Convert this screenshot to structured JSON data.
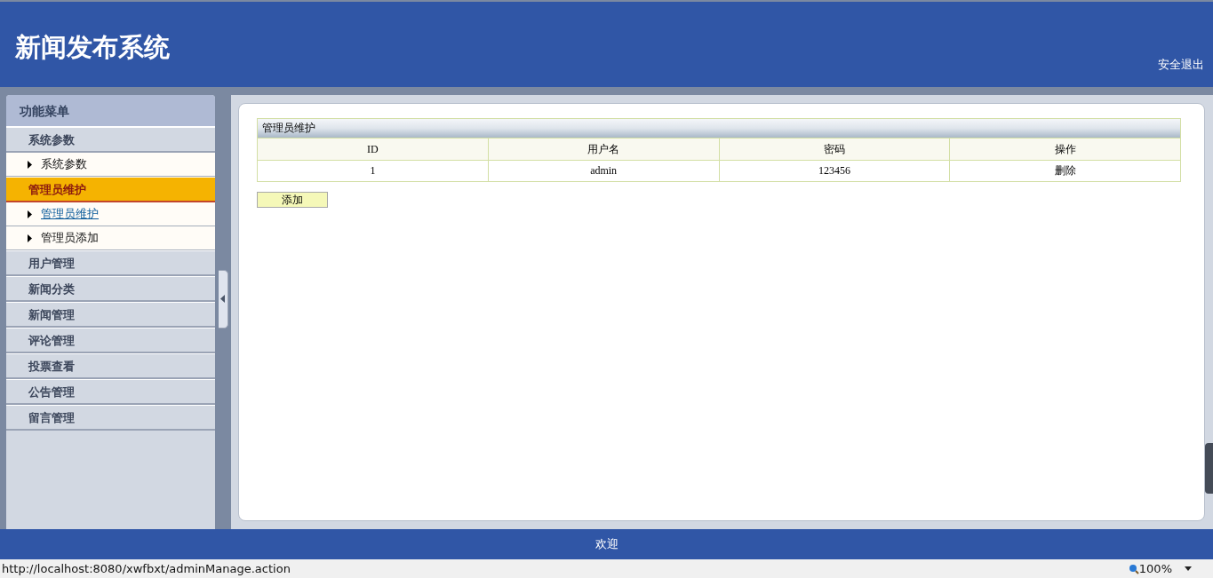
{
  "header": {
    "title": "新闻发布系统",
    "logout": "安全退出"
  },
  "sidebar": {
    "title": "功能菜单",
    "groups": [
      {
        "label": "系统参数",
        "selected": false,
        "children": [
          {
            "label": "系统参数",
            "selected": false
          }
        ]
      },
      {
        "label": "管理员维护",
        "selected": true,
        "children": [
          {
            "label": "管理员维护",
            "selected": true
          },
          {
            "label": "管理员添加",
            "selected": false
          }
        ]
      },
      {
        "label": "用户管理",
        "selected": false
      },
      {
        "label": "新闻分类",
        "selected": false
      },
      {
        "label": "新闻管理",
        "selected": false
      },
      {
        "label": "评论管理",
        "selected": false
      },
      {
        "label": "投票查看",
        "selected": false
      },
      {
        "label": "公告管理",
        "selected": false
      },
      {
        "label": "留言管理",
        "selected": false
      }
    ]
  },
  "panel": {
    "title": "管理员维护",
    "table": {
      "columns": [
        "ID",
        "用户名",
        "密码",
        "操作"
      ],
      "rows": [
        [
          "1",
          "admin",
          "123456",
          "删除"
        ]
      ]
    },
    "add_button": "添加"
  },
  "footer": "欢迎",
  "status_bar": {
    "url": "http://localhost:8080/xwfbxt/adminManage.action",
    "zoom": "100%"
  }
}
